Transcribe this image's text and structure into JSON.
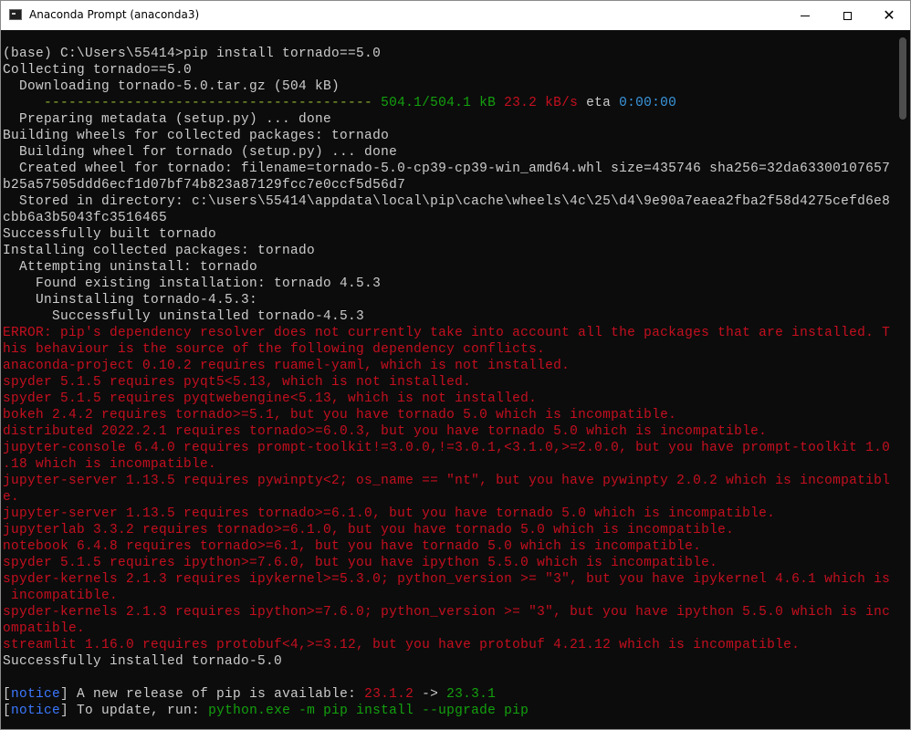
{
  "window": {
    "title": "Anaconda Prompt (anaconda3)",
    "icon": "terminal-icon",
    "controls": [
      "minimize-icon",
      "maximize-icon",
      "close-icon"
    ]
  },
  "console": {
    "lines": [
      [
        {
          "t": "(base) C:\\Users\\55414>pip install tornado==5.0",
          "c": ""
        }
      ],
      [
        {
          "t": "Collecting tornado==5.0",
          "c": ""
        }
      ],
      [
        {
          "t": "  Downloading tornado-5.0.tar.gz (504 kB)",
          "c": ""
        }
      ],
      [
        {
          "t": "     ---------------------------------------- ",
          "c": "c-bar"
        },
        {
          "t": "504.1/504.1 kB",
          "c": "c-green"
        },
        {
          "t": " ",
          "c": ""
        },
        {
          "t": "23.2 kB/s",
          "c": "c-red"
        },
        {
          "t": " eta ",
          "c": ""
        },
        {
          "t": "0:00:00",
          "c": "c-dim"
        }
      ],
      [
        {
          "t": "  Preparing metadata (setup.py) ... done",
          "c": ""
        }
      ],
      [
        {
          "t": "Building wheels for collected packages: tornado",
          "c": ""
        }
      ],
      [
        {
          "t": "  Building wheel for tornado (setup.py) ... done",
          "c": ""
        }
      ],
      [
        {
          "t": "  Created wheel for tornado: filename=tornado-5.0-cp39-cp39-win_amd64.whl size=435746 sha256=32da63300107657",
          "c": ""
        }
      ],
      [
        {
          "t": "b25a57505ddd6ecf1d07bf74b823a87129fcc7e0ccf5d56d7",
          "c": ""
        }
      ],
      [
        {
          "t": "  Stored in directory: c:\\users\\55414\\appdata\\local\\pip\\cache\\wheels\\4c\\25\\d4\\9e90a7eaea2fba2f58d4275cefd6e8",
          "c": ""
        }
      ],
      [
        {
          "t": "cbb6a3b5043fc3516465",
          "c": ""
        }
      ],
      [
        {
          "t": "Successfully built tornado",
          "c": ""
        }
      ],
      [
        {
          "t": "Installing collected packages: tornado",
          "c": ""
        }
      ],
      [
        {
          "t": "  Attempting uninstall: tornado",
          "c": ""
        }
      ],
      [
        {
          "t": "    Found existing installation: tornado 4.5.3",
          "c": ""
        }
      ],
      [
        {
          "t": "    Uninstalling tornado-4.5.3:",
          "c": ""
        }
      ],
      [
        {
          "t": "      Successfully uninstalled tornado-4.5.3",
          "c": ""
        }
      ],
      [
        {
          "t": "ERROR: pip's dependency resolver does not currently take into account all the packages that are installed. T",
          "c": "c-red"
        }
      ],
      [
        {
          "t": "his behaviour is the source of the following dependency conflicts.",
          "c": "c-red"
        }
      ],
      [
        {
          "t": "anaconda-project 0.10.2 requires ruamel-yaml, which is not installed.",
          "c": "c-red"
        }
      ],
      [
        {
          "t": "spyder 5.1.5 requires pyqt5<5.13, which is not installed.",
          "c": "c-red"
        }
      ],
      [
        {
          "t": "spyder 5.1.5 requires pyqtwebengine<5.13, which is not installed.",
          "c": "c-red"
        }
      ],
      [
        {
          "t": "bokeh 2.4.2 requires tornado>=5.1, but you have tornado 5.0 which is incompatible.",
          "c": "c-red"
        }
      ],
      [
        {
          "t": "distributed 2022.2.1 requires tornado>=6.0.3, but you have tornado 5.0 which is incompatible.",
          "c": "c-red"
        }
      ],
      [
        {
          "t": "jupyter-console 6.4.0 requires prompt-toolkit!=3.0.0,!=3.0.1,<3.1.0,>=2.0.0, but you have prompt-toolkit 1.0",
          "c": "c-red"
        }
      ],
      [
        {
          "t": ".18 which is incompatible.",
          "c": "c-red"
        }
      ],
      [
        {
          "t": "jupyter-server 1.13.5 requires pywinpty<2; os_name == \"nt\", but you have pywinpty 2.0.2 which is incompatibl",
          "c": "c-red"
        }
      ],
      [
        {
          "t": "e.",
          "c": "c-red"
        }
      ],
      [
        {
          "t": "jupyter-server 1.13.5 requires tornado>=6.1.0, but you have tornado 5.0 which is incompatible.",
          "c": "c-red"
        }
      ],
      [
        {
          "t": "jupyterlab 3.3.2 requires tornado>=6.1.0, but you have tornado 5.0 which is incompatible.",
          "c": "c-red"
        }
      ],
      [
        {
          "t": "notebook 6.4.8 requires tornado>=6.1, but you have tornado 5.0 which is incompatible.",
          "c": "c-red"
        }
      ],
      [
        {
          "t": "spyder 5.1.5 requires ipython>=7.6.0, but you have ipython 5.5.0 which is incompatible.",
          "c": "c-red"
        }
      ],
      [
        {
          "t": "spyder-kernels 2.1.3 requires ipykernel>=5.3.0; python_version >= \"3\", but you have ipykernel 4.6.1 which is",
          "c": "c-red"
        }
      ],
      [
        {
          "t": " incompatible.",
          "c": "c-red"
        }
      ],
      [
        {
          "t": "spyder-kernels 2.1.3 requires ipython>=7.6.0; python_version >= \"3\", but you have ipython 5.5.0 which is inc",
          "c": "c-red"
        }
      ],
      [
        {
          "t": "ompatible.",
          "c": "c-red"
        }
      ],
      [
        {
          "t": "streamlit 1.16.0 requires protobuf<4,>=3.12, but you have protobuf 4.21.12 which is incompatible.",
          "c": "c-red"
        }
      ],
      [
        {
          "t": "Successfully installed tornado-5.0",
          "c": ""
        }
      ],
      [
        {
          "t": "",
          "c": ""
        }
      ],
      [
        {
          "t": "[",
          "c": ""
        },
        {
          "t": "notice",
          "c": "c-blue"
        },
        {
          "t": "] A new release of pip is available: ",
          "c": ""
        },
        {
          "t": "23.1.2",
          "c": "c-red"
        },
        {
          "t": " -> ",
          "c": ""
        },
        {
          "t": "23.3.1",
          "c": "c-green"
        }
      ],
      [
        {
          "t": "[",
          "c": ""
        },
        {
          "t": "notice",
          "c": "c-blue"
        },
        {
          "t": "] To update, run: ",
          "c": ""
        },
        {
          "t": "python.exe -m pip install --upgrade pip",
          "c": "c-green"
        }
      ]
    ]
  },
  "colors": {
    "background": "#0c0c0c",
    "text": "#cccccc",
    "error": "#c50f1f",
    "success": "#13a10e",
    "notice": "#3b78ff",
    "eta": "#3a96dd",
    "progress_bar": "#8fb531"
  }
}
